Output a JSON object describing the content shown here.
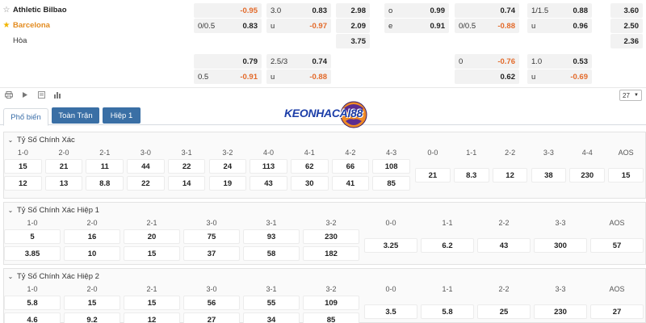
{
  "match": {
    "home": "Athletic Bilbao",
    "away": "Barcelona",
    "draw": "Hòa"
  },
  "odds_rows": [
    [
      {
        "lab": "",
        "val": "-0.95",
        "neg": true
      },
      {
        "lab": "3.0",
        "val": "0.83",
        "neg": false
      },
      {
        "lab": "",
        "val": "2.98",
        "neg": false
      },
      {
        "lab": "o",
        "val": "0.99",
        "neg": false
      },
      {
        "lab": "",
        "val": "0.74",
        "neg": false
      },
      {
        "lab": "1/1.5",
        "val": "0.88",
        "neg": false
      },
      {
        "lab": "",
        "val": "3.60",
        "neg": false
      }
    ],
    [
      {
        "lab": "0/0.5",
        "val": "0.83",
        "neg": false
      },
      {
        "lab": "u",
        "val": "-0.97",
        "neg": true
      },
      {
        "lab": "",
        "val": "2.09",
        "neg": false
      },
      {
        "lab": "e",
        "val": "0.91",
        "neg": false
      },
      {
        "lab": "0/0.5",
        "val": "-0.88",
        "neg": true
      },
      {
        "lab": "u",
        "val": "0.96",
        "neg": false
      },
      {
        "lab": "",
        "val": "2.50",
        "neg": false
      }
    ],
    [
      {
        "lab": "",
        "val": "",
        "neg": false
      },
      {
        "lab": "",
        "val": "",
        "neg": false
      },
      {
        "lab": "",
        "val": "3.75",
        "neg": false
      },
      {
        "lab": "",
        "val": "",
        "neg": false
      },
      {
        "lab": "",
        "val": "",
        "neg": false
      },
      {
        "lab": "",
        "val": "",
        "neg": false
      },
      {
        "lab": "",
        "val": "2.36",
        "neg": false
      }
    ],
    [
      {
        "lab": "",
        "val": "0.79",
        "neg": false
      },
      {
        "lab": "2.5/3",
        "val": "0.74",
        "neg": false
      },
      {
        "lab": "",
        "val": "",
        "neg": false
      },
      {
        "lab": "",
        "val": "",
        "neg": false
      },
      {
        "lab": "0",
        "val": "-0.76",
        "neg": true
      },
      {
        "lab": "1.0",
        "val": "0.53",
        "neg": false
      },
      {
        "lab": "",
        "val": "",
        "neg": false
      }
    ],
    [
      {
        "lab": "0.5",
        "val": "-0.91",
        "neg": true
      },
      {
        "lab": "u",
        "val": "-0.88",
        "neg": true
      },
      {
        "lab": "",
        "val": "",
        "neg": false
      },
      {
        "lab": "",
        "val": "",
        "neg": false
      },
      {
        "lab": "",
        "val": "0.62",
        "neg": false
      },
      {
        "lab": "u",
        "val": "-0.69",
        "neg": true
      },
      {
        "lab": "",
        "val": "",
        "neg": false
      }
    ]
  ],
  "toolbar": {
    "page_size": "27"
  },
  "tabs": [
    "Phổ biến",
    "Toàn Trận",
    "Hiệp 1"
  ],
  "logo": {
    "text": "KEONHACAI88"
  },
  "sections": [
    {
      "title": "Tỷ Số Chính Xác",
      "left_headers": [
        "1-0",
        "2-0",
        "2-1",
        "3-0",
        "3-1",
        "3-2",
        "4-0",
        "4-1",
        "4-2",
        "4-3"
      ],
      "left_rows": [
        [
          "15",
          "21",
          "11",
          "44",
          "22",
          "24",
          "113",
          "62",
          "66",
          "108"
        ],
        [
          "12",
          "13",
          "8.8",
          "22",
          "14",
          "19",
          "43",
          "30",
          "41",
          "85"
        ]
      ],
      "right_headers": [
        "0-0",
        "1-1",
        "2-2",
        "3-3",
        "4-4",
        "AOS"
      ],
      "right_values": [
        "21",
        "8.3",
        "12",
        "38",
        "230",
        "15"
      ]
    },
    {
      "title": "Tỷ Số Chính Xác Hiệp 1",
      "left_headers": [
        "1-0",
        "2-0",
        "2-1",
        "3-0",
        "3-1",
        "3-2"
      ],
      "left_rows": [
        [
          "5",
          "16",
          "20",
          "75",
          "93",
          "230"
        ],
        [
          "3.85",
          "10",
          "15",
          "37",
          "58",
          "182"
        ]
      ],
      "right_headers": [
        "0-0",
        "1-1",
        "2-2",
        "3-3",
        "AOS"
      ],
      "right_values": [
        "3.25",
        "6.2",
        "43",
        "300",
        "57"
      ]
    },
    {
      "title": "Tỷ Số Chính Xác Hiệp 2",
      "left_headers": [
        "1-0",
        "2-0",
        "2-1",
        "3-0",
        "3-1",
        "3-2"
      ],
      "left_rows": [
        [
          "5.8",
          "15",
          "15",
          "56",
          "55",
          "109"
        ],
        [
          "4.6",
          "9.2",
          "12",
          "27",
          "34",
          "85"
        ]
      ],
      "right_headers": [
        "0-0",
        "1-1",
        "2-2",
        "3-3",
        "AOS"
      ],
      "right_values": [
        "3.5",
        "5.8",
        "25",
        "230",
        "27"
      ]
    }
  ]
}
